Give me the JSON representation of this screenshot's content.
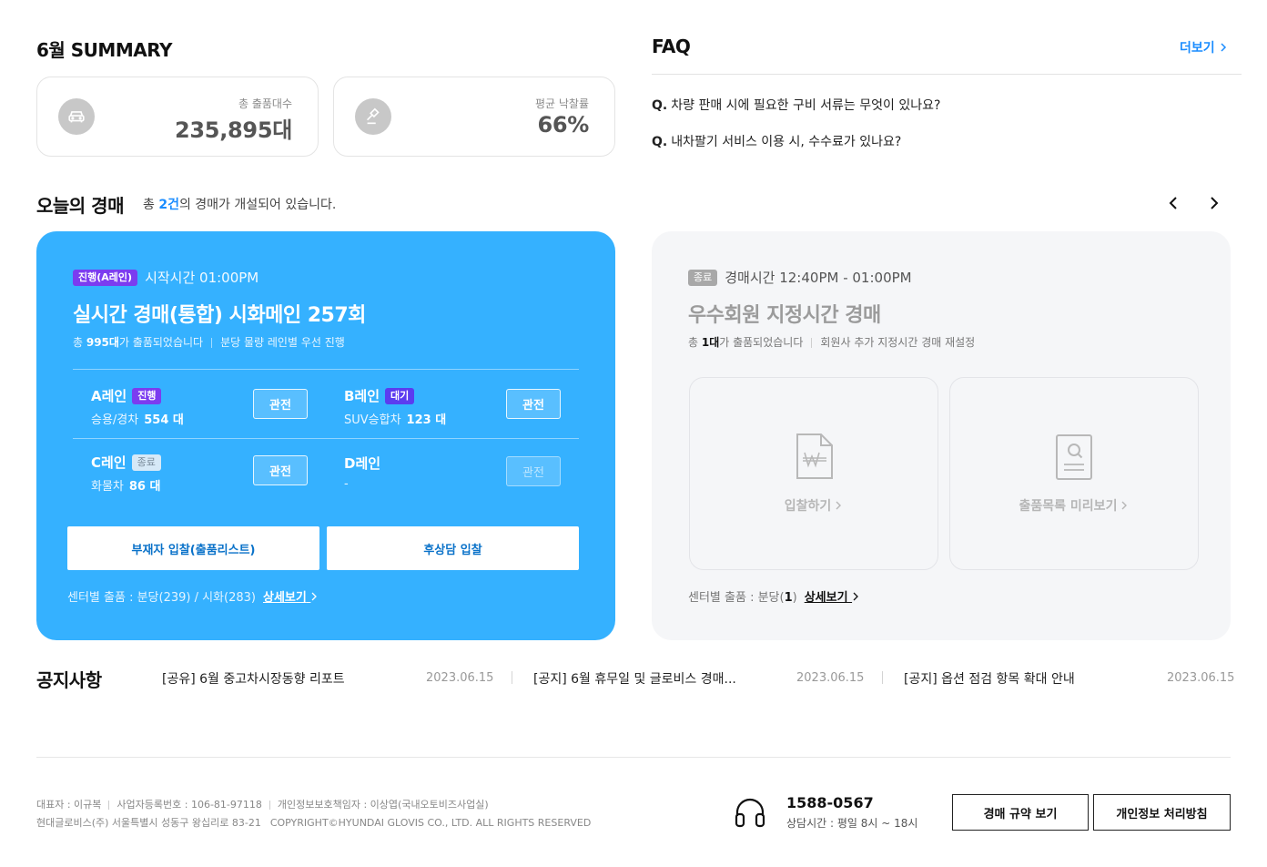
{
  "summary": {
    "title": "6월 SUMMARY",
    "cards": [
      {
        "label": "총 출품대수",
        "value": "235,895대",
        "icon": "car-icon"
      },
      {
        "label": "평균 낙찰률",
        "value": "66%",
        "icon": "gavel-icon"
      }
    ]
  },
  "faq": {
    "title": "FAQ",
    "more_label": "더보기",
    "items": [
      {
        "q": "Q.",
        "text": "차량 판매 시에 필요한 구비 서류는 무엇이 있나요?"
      },
      {
        "q": "Q.",
        "text": "내차팔기 서비스 이용 시, 수수료가 있나요?"
      }
    ]
  },
  "today": {
    "title": "오늘의 경매",
    "sub_prefix": "총 ",
    "sub_count": "2건",
    "sub_suffix": "의 경매가 개설되어 있습니다."
  },
  "auction_live": {
    "badge": "진행(A레인)",
    "time": "시작시간 01:00PM",
    "title": "실시간 경매(통합) 시화메인 257회",
    "meta_prefix": "총 ",
    "meta_count": "995대",
    "meta_suffix": "가 출품되었습니다",
    "meta_note": "분당 물량 레인별 우선 진행",
    "lanes": [
      {
        "name": "A레인",
        "status": "진행",
        "type": "승용/경차",
        "count": "554 대",
        "watch": "관전"
      },
      {
        "name": "B레인",
        "status": "대기",
        "type": "SUV승합차",
        "count": "123 대",
        "watch": "관전"
      },
      {
        "name": "C레인",
        "status": "종료",
        "type": "화물차",
        "count": "86 대",
        "watch": "관전"
      },
      {
        "name": "D레인",
        "status": "",
        "type": "-",
        "count": "",
        "watch": "관전"
      }
    ],
    "btn_absentee": "부재자 입찰(출품리스트)",
    "btn_post": "후상담 입찰",
    "center_text": "센터별 출품 : 분당(239) / 시화(283)",
    "detail": "상세보기"
  },
  "auction_ended": {
    "badge": "종료",
    "time": "경매시간 12:40PM -  01:00PM",
    "title": "우수회원 지정시간 경매",
    "meta_prefix": "총 ",
    "meta_count": "1대",
    "meta_suffix": "가 출품되었습니다",
    "meta_note": "회원사 추가 지정시간 경매 재설정",
    "action_bid": "입찰하기",
    "action_preview": "출품목록 미리보기",
    "center_prefix": "센터별 출품 : 분당(",
    "center_count": "1",
    "center_suffix": ")",
    "detail": "상세보기"
  },
  "notice": {
    "title": "공지사항",
    "items": [
      {
        "text": "[공유] 6월 중고차시장동향 리포트",
        "date": "2023.06.15"
      },
      {
        "text": "[공지] 6월 휴무일 및 글로비스 경매...",
        "date": "2023.06.15"
      },
      {
        "text": "[공지] 옵션 점검 항목 확대 안내",
        "date": "2023.06.15"
      }
    ]
  },
  "footer": {
    "ceo": "대표자 : 이규복",
    "biz_no": "사업자등록번호 : 106-81-97118",
    "privacy_officer": "개인정보보호책임자 : 이상엽(국내오토비즈사업실)",
    "address": "현대글로비스(주) 서울특별시 성동구 왕십리로 83-21",
    "copyright": "COPYRIGHT©HYUNDAI GLOVIS CO., LTD. ALL RIGHTS RESERVED",
    "phone": "1588-0567",
    "hours": "상담시간 : 평일 8시 ~ 18시",
    "btn_rules": "경매 규약 보기",
    "btn_privacy": "개인정보 처리방침"
  },
  "colors": {
    "accent": "#1a8cff",
    "live_card": "#35b1ff",
    "purple_badge": "#7b3cf0",
    "ended_card": "#f5f6f8"
  }
}
